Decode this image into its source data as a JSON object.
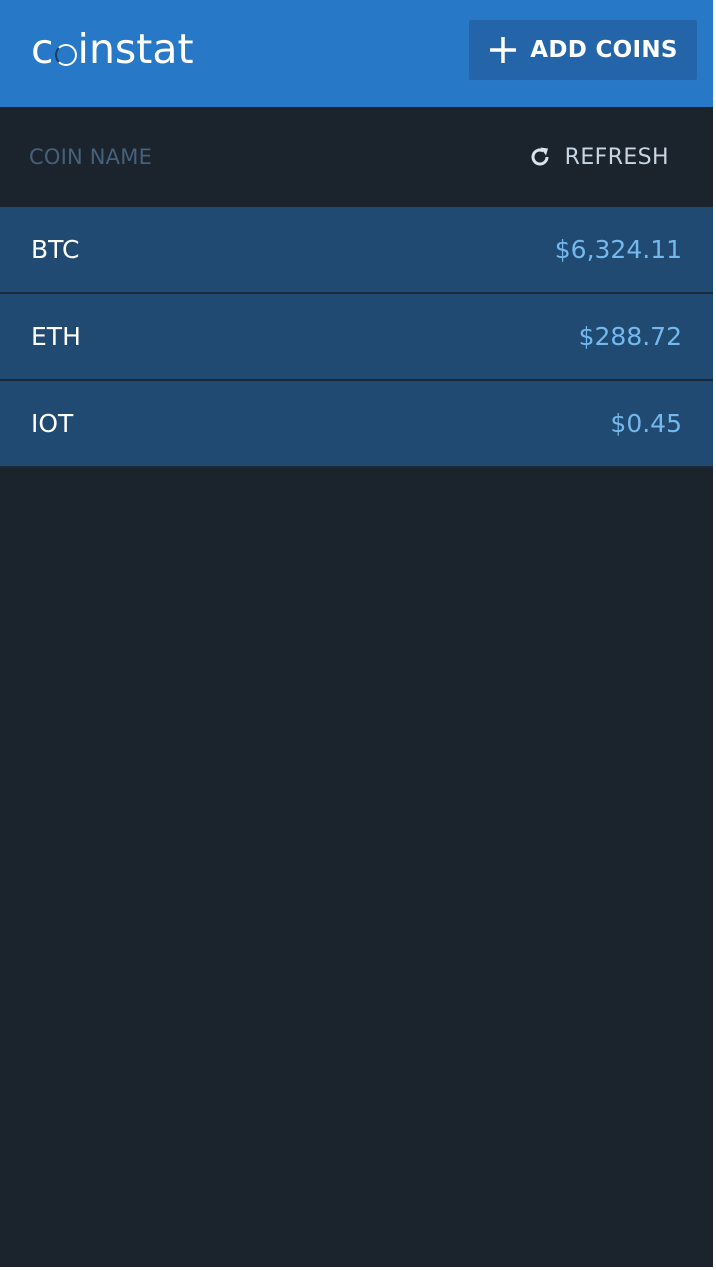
{
  "header": {
    "logo_text_1": "c",
    "logo_text_2": "instat",
    "add_button_label": "ADD COINS",
    "add_icon": "plus-icon"
  },
  "subheader": {
    "column_label": "COIN NAME",
    "refresh_label": "REFRESH",
    "refresh_icon": "refresh-icon"
  },
  "coins": [
    {
      "name": "BTC",
      "price": "$6,324.11"
    },
    {
      "name": "ETH",
      "price": "$288.72"
    },
    {
      "name": "IOT",
      "price": "$0.45"
    }
  ],
  "colors": {
    "header_bg": "#2878c8",
    "button_bg": "#2365a8",
    "app_bg": "#1b232c",
    "row_bg": "#204a71",
    "price_text": "#74b8ee"
  }
}
